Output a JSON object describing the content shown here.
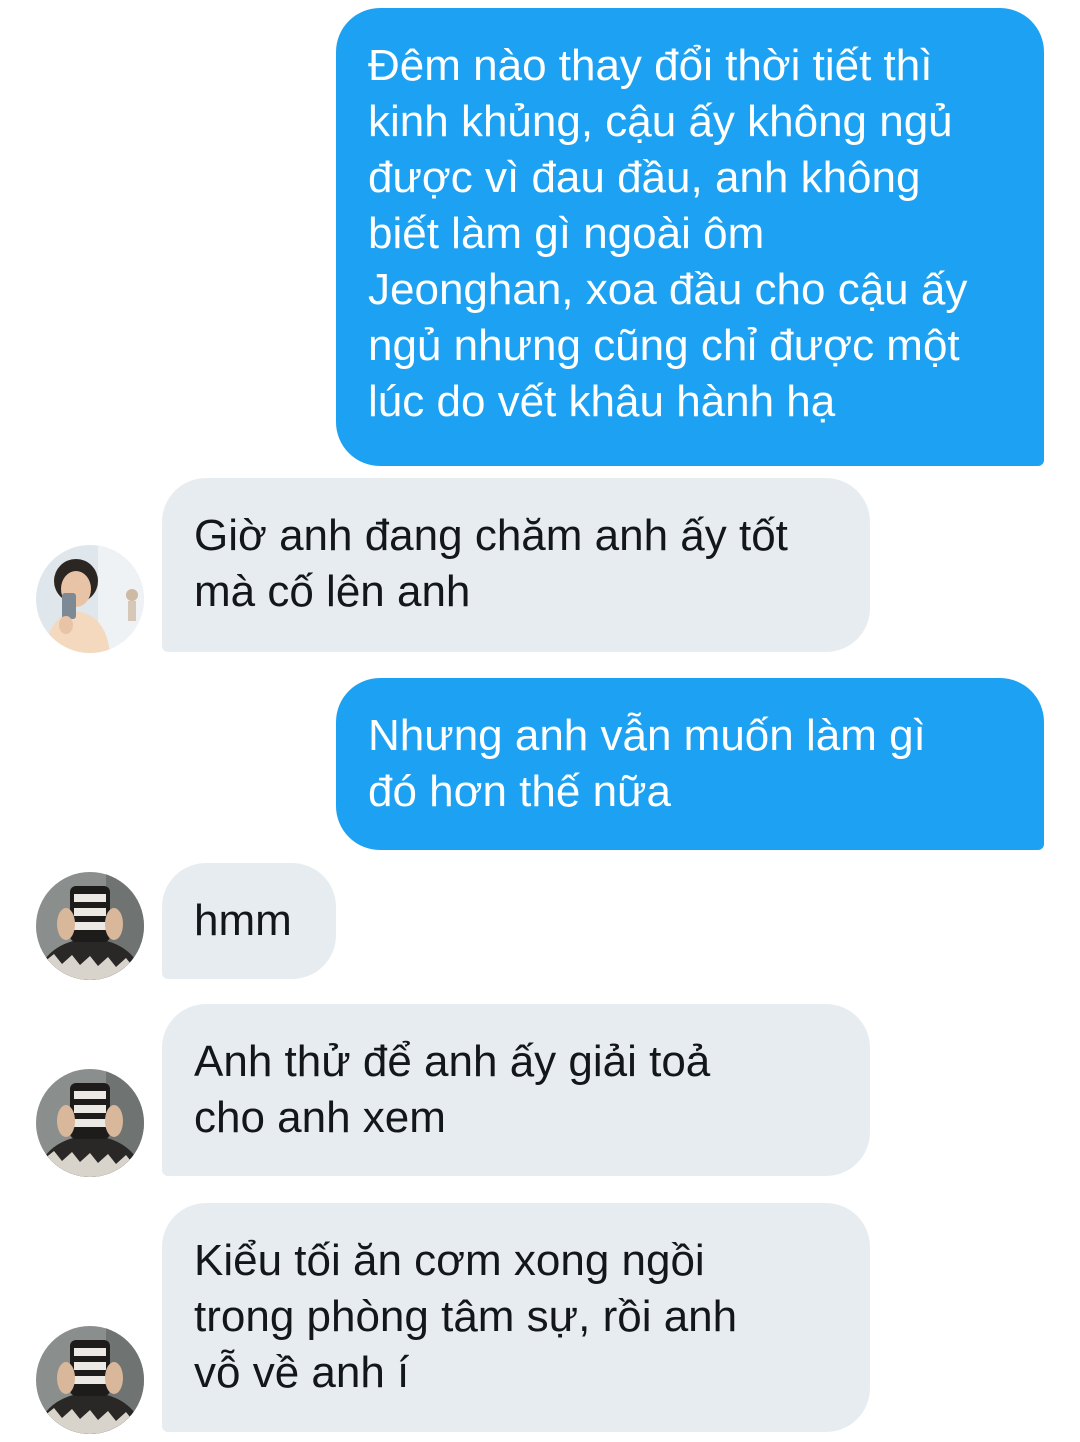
{
  "messages": [
    {
      "direction": "sent",
      "text": "Đêm nào thay đổi thời tiết thì\nkinh khủng, cậu ấy không ngủ\nđược vì đau đầu, anh không\nbiết làm gì ngoài ôm\nJeonghan, xoa đầu cho cậu ấy\nngủ nhưng cũng chỉ được một\nlúc do vết khâu hành hạ"
    },
    {
      "direction": "received",
      "text": "Giờ anh đang chăm anh ấy tốt\nmà cố lên anh",
      "avatar": "user-avatar-mirror-selfie"
    },
    {
      "direction": "sent",
      "text": "Nhưng anh vẫn muốn làm gì\nđó hơn thế nữa"
    },
    {
      "direction": "received",
      "text": "hmm",
      "avatar": "user-avatar-phone-cover"
    },
    {
      "direction": "received",
      "text": "Anh thử để anh ấy giải toả\ncho anh xem",
      "avatar": "user-avatar-phone-cover"
    },
    {
      "direction": "received",
      "text": "Kiểu tối ăn cơm xong ngồi\ntrong phòng tâm sự, rồi anh\nvỗ về anh í",
      "avatar": "user-avatar-phone-cover"
    }
  ],
  "colors": {
    "sent_bubble": "#1da1f2",
    "received_bubble": "#e6ecf0",
    "received_text": "#14171a",
    "sent_text": "#ffffff"
  }
}
